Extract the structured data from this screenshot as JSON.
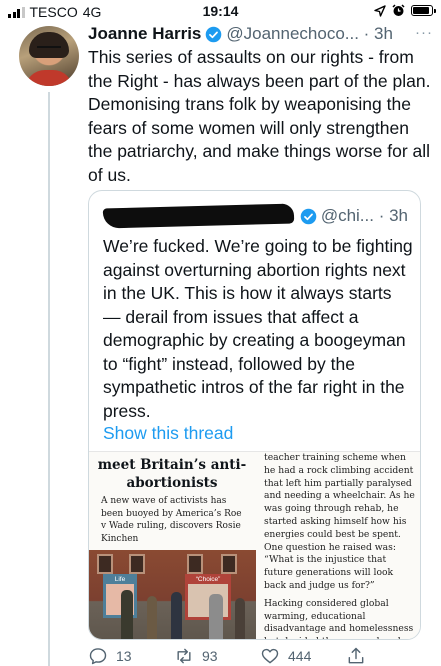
{
  "status_bar": {
    "carrier": "TESCO",
    "network": "4G",
    "time": "19:14",
    "icons": [
      "location-icon",
      "alarm-icon",
      "battery-icon"
    ]
  },
  "tweet": {
    "author_name": "Joanne Harris",
    "handle_time": "@Joannechoco... · 3h",
    "more": "···",
    "text": "This series of assaults on our rights - from the Right - has always been part of the plan. Demonising trans folk by weaponising the fears of some women will only strengthen the patriarchy, and make things worse for all of us."
  },
  "quote": {
    "handle_time": "@chi... · 3h",
    "text": "We’re fucked. We’re going to be fighting against overturning abortion rights next in the UK. This is how it always starts — derail from issues that affect a demographic by creating a boogeyman to “fight” instead, followed by the sympathetic intros of the far right in the press.",
    "show_thread": "Show this thread",
    "article": {
      "title": "meet Britain’s anti-abortionists",
      "standfirst": "A new wave of activists has been buoyed by America’s Roe v Wade ruling, discovers Rosie Kinchen",
      "sign_left": "Life",
      "sign_right": "“Choice”",
      "paragraph1": "teacher training scheme when he had a rock climbing accident that left him partially paralysed and needing a wheelchair. As he was going through rehab, he started asking himself how his energies could best be spent. One question he raised was: “What is the injustice that future generations will look back and judge us for?”",
      "paragraph2": "Hacking considered global warming, educational disadvantage and homelessness but decided they were already well catered for. “Then I ran"
    }
  },
  "actions": {
    "replies": "13",
    "retweets": "93",
    "likes": "444"
  },
  "colors": {
    "link": "#1d9bf0",
    "muted": "#536471",
    "verified": "#1d9bf0",
    "border": "#cfd9de"
  }
}
